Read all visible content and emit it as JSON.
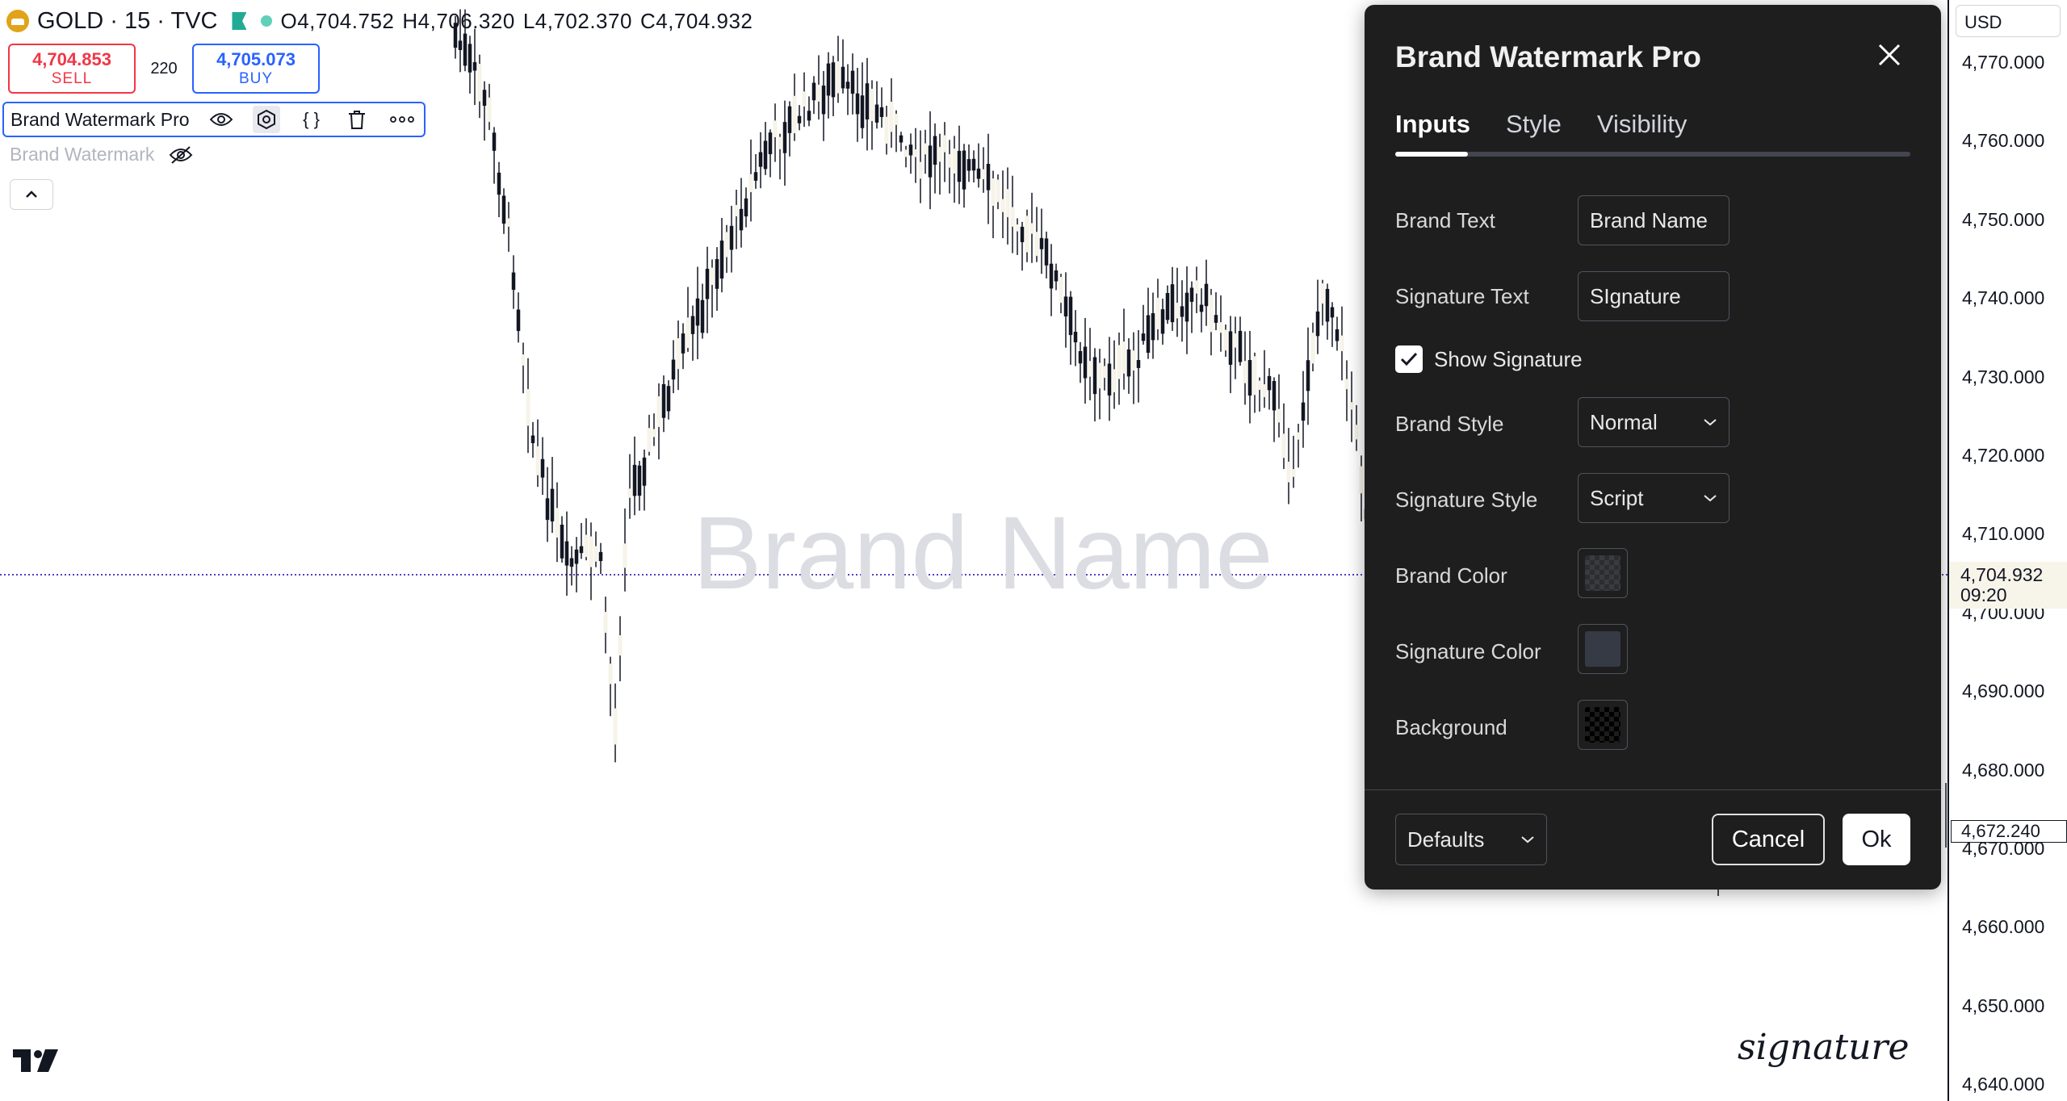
{
  "symbol": {
    "title": "GOLD · 15 · TVC",
    "open": "O4,704.752",
    "high": "H4,706.320",
    "low": "L4,702.370",
    "close": "C4,704.932"
  },
  "trade": {
    "sell_price": "4,704.853",
    "sell_label": "SELL",
    "spread": "220",
    "buy_price": "4,705.073",
    "buy_label": "BUY"
  },
  "indicator": {
    "name": "Brand Watermark Pro",
    "hidden_name": "Brand Watermark",
    "icons": [
      "eye-icon",
      "settings-icon",
      "source-code-icon",
      "trash-icon",
      "more-icon"
    ]
  },
  "watermark": {
    "brand_text": "Brand Name",
    "signature_text": "signature"
  },
  "price_scale": {
    "currency": "USD",
    "ticks": [
      "4,770.000",
      "4,760.000",
      "4,750.000",
      "4,740.000",
      "4,730.000",
      "4,720.000",
      "4,710.000",
      "4,700.000",
      "4,690.000",
      "4,680.000",
      "4,670.000",
      "4,660.000",
      "4,650.000",
      "4,640.000"
    ],
    "last_price": "4,704.932",
    "countdown": "09:20",
    "low_marker": "4,672.240"
  },
  "dialog": {
    "title": "Brand Watermark Pro",
    "tabs": [
      {
        "label": "Inputs",
        "active": true
      },
      {
        "label": "Style",
        "active": false
      },
      {
        "label": "Visibility",
        "active": false
      }
    ],
    "fields": {
      "brand_text_label": "Brand Text",
      "brand_text_value": "Brand Name",
      "signature_text_label": "Signature Text",
      "signature_text_value": "SIgnature",
      "show_signature_label": "Show Signature",
      "show_signature_checked": true,
      "brand_style_label": "Brand Style",
      "brand_style_value": "Normal",
      "signature_style_label": "Signature Style",
      "signature_style_value": "Script",
      "brand_color_label": "Brand Color",
      "brand_color_value": "#dcdde3",
      "signature_color_label": "Signature Color",
      "signature_color_value": "#363a45",
      "background_label": "Background",
      "background_value": "#000000"
    },
    "footer": {
      "defaults_label": "Defaults",
      "cancel_label": "Cancel",
      "ok_label": "Ok"
    }
  },
  "colors": {
    "sell": "#f23645",
    "buy": "#2962ff",
    "dialog_bg": "#1e1e1e",
    "last_price_line": "#5b3cc4"
  }
}
